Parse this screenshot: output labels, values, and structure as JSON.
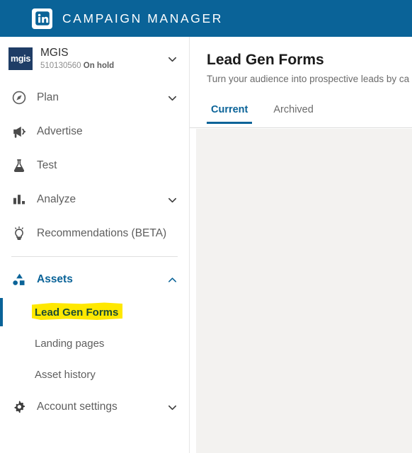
{
  "header": {
    "brand": "CAMPAIGN MANAGER",
    "logo_icon": "linkedin-logo-icon",
    "brand_color": "#0a6398"
  },
  "sidebar": {
    "account": {
      "logo_text": "mgis",
      "name": "MGIS",
      "account_id": "510130560",
      "status": "On hold",
      "chevron_icon": "chevron-down-icon"
    },
    "nav": [
      {
        "label": "Plan",
        "icon": "compass-icon",
        "chevron": "chevron-down-icon",
        "expandable": true
      },
      {
        "label": "Advertise",
        "icon": "megaphone-icon",
        "chevron": "",
        "expandable": false
      },
      {
        "label": "Test",
        "icon": "flask-icon",
        "chevron": "",
        "expandable": false
      },
      {
        "label": "Analyze",
        "icon": "bar-chart-icon",
        "chevron": "chevron-down-icon",
        "expandable": true
      },
      {
        "label": "Recommendations (BETA)",
        "icon": "lightbulb-icon",
        "chevron": "",
        "expandable": false
      }
    ],
    "assets": {
      "label": "Assets",
      "icon": "shapes-icon",
      "chevron": "chevron-up-icon",
      "expanded": true,
      "items": [
        {
          "label": "Lead Gen Forms",
          "active": true,
          "highlighted": true
        },
        {
          "label": "Landing pages",
          "active": false,
          "highlighted": false
        },
        {
          "label": "Asset history",
          "active": false,
          "highlighted": false
        }
      ]
    },
    "account_settings": {
      "label": "Account settings",
      "icon": "gear-icon",
      "chevron": "chevron-down-icon"
    }
  },
  "main": {
    "title": "Lead Gen Forms",
    "subtitle": "Turn your audience into prospective leads by ca",
    "tabs": [
      {
        "label": "Current",
        "active": true
      },
      {
        "label": "Archived",
        "active": false
      }
    ]
  },
  "colors": {
    "brand_blue": "#0a6398",
    "highlight_yellow": "#ffe800",
    "content_bg": "#f3f2f0",
    "account_logo_navy": "#1f3d66"
  }
}
